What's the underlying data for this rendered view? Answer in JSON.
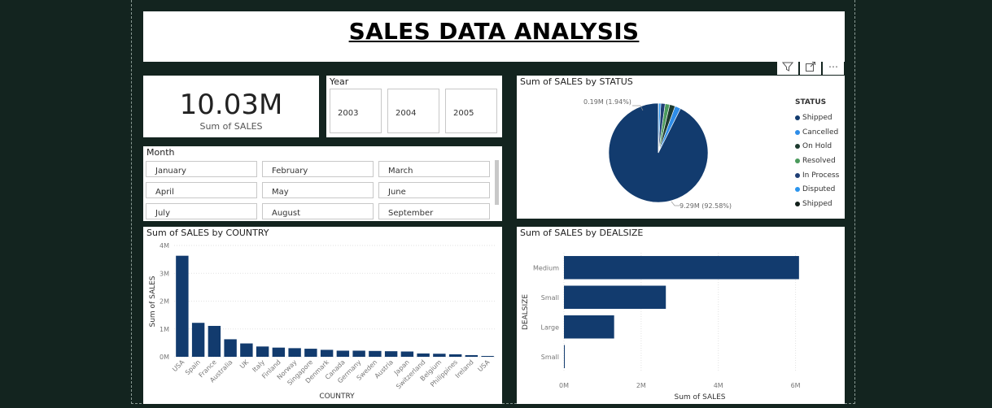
{
  "report": {
    "title": "SALES DATA ANALYSIS"
  },
  "toolbar": {
    "icons": [
      "filter-icon",
      "focus-mode-icon",
      "more-options-icon"
    ],
    "more_glyph": "⋯"
  },
  "kpi": {
    "value": "10.03M",
    "label": "Sum of SALES"
  },
  "year_slicer": {
    "title": "Year",
    "options": [
      "2003",
      "2004",
      "2005"
    ]
  },
  "month_slicer": {
    "title": "Month",
    "options": [
      "January",
      "February",
      "March",
      "April",
      "May",
      "June",
      "July",
      "August",
      "September"
    ]
  },
  "status_chart": {
    "title": "Sum of SALES by STATUS",
    "label_small": "0.19M (1.94%)",
    "label_large": "9.29M (92.58%)",
    "legend_title": "STATUS",
    "legend": [
      {
        "name": "Shipped",
        "color": "#123b6e"
      },
      {
        "name": "Cancelled",
        "color": "#2e8de8"
      },
      {
        "name": "On Hold",
        "color": "#1d3b2f"
      },
      {
        "name": "Resolved",
        "color": "#4a9a5c"
      },
      {
        "name": "In Process",
        "color": "#1f3f75"
      },
      {
        "name": "Disputed",
        "color": "#2b95ee"
      },
      {
        "name": "Shipped",
        "color": "#111f1a"
      }
    ]
  },
  "country_chart": {
    "title": "Sum of SALES by COUNTRY",
    "xlabel": "COUNTRY",
    "ylabel": "Sum of SALES",
    "yticks": [
      "0M",
      "1M",
      "2M",
      "3M",
      "4M"
    ]
  },
  "dealsize_chart": {
    "title": "Sum of SALES by DEALSIZE",
    "xlabel": "Sum of SALES",
    "ylabel": "DEALSIZE",
    "xticks": [
      "0M",
      "2M",
      "4M",
      "6M"
    ]
  },
  "chart_data": [
    {
      "type": "pie",
      "title": "Sum of SALES by STATUS",
      "categories": [
        "Shipped",
        "Cancelled",
        "On Hold",
        "Resolved",
        "In Process",
        "Disputed",
        "Shipped"
      ],
      "values": [
        9.29,
        0.19,
        0.18,
        0.15,
        0.14,
        0.07,
        0.01
      ],
      "colors": [
        "#123b6e",
        "#2e8de8",
        "#1d3b2f",
        "#4a9a5c",
        "#1f3f75",
        "#2b95ee",
        "#111f1a"
      ],
      "legend_position": "right"
    },
    {
      "type": "bar",
      "title": "Sum of SALES by COUNTRY",
      "xlabel": "COUNTRY",
      "ylabel": "Sum of SALES",
      "categories": [
        "USA",
        "Spain",
        "France",
        "Australia",
        "UK",
        "Italy",
        "Finland",
        "Norway",
        "Singapore",
        "Denmark",
        "Canada",
        "Germany",
        "Sweden",
        "Austria",
        "Japan",
        "Switzerland",
        "Belgium",
        "Philippines",
        "Ireland",
        "USA"
      ],
      "values": [
        3.63,
        1.22,
        1.11,
        0.63,
        0.48,
        0.37,
        0.33,
        0.31,
        0.29,
        0.25,
        0.22,
        0.22,
        0.21,
        0.2,
        0.19,
        0.12,
        0.11,
        0.09,
        0.06,
        0.03
      ],
      "ylim": [
        0,
        4
      ],
      "color": "#123b6e",
      "grid": true
    },
    {
      "type": "bar",
      "orientation": "horizontal",
      "title": "Sum of SALES by DEALSIZE",
      "xlabel": "Sum of SALES",
      "ylabel": "DEALSIZE",
      "categories": [
        "Medium",
        "Small",
        "Large",
        "Small"
      ],
      "values": [
        6.09,
        2.64,
        1.3,
        0.01
      ],
      "xlim": [
        0,
        7
      ],
      "color": "#123b6e",
      "grid": true
    }
  ]
}
